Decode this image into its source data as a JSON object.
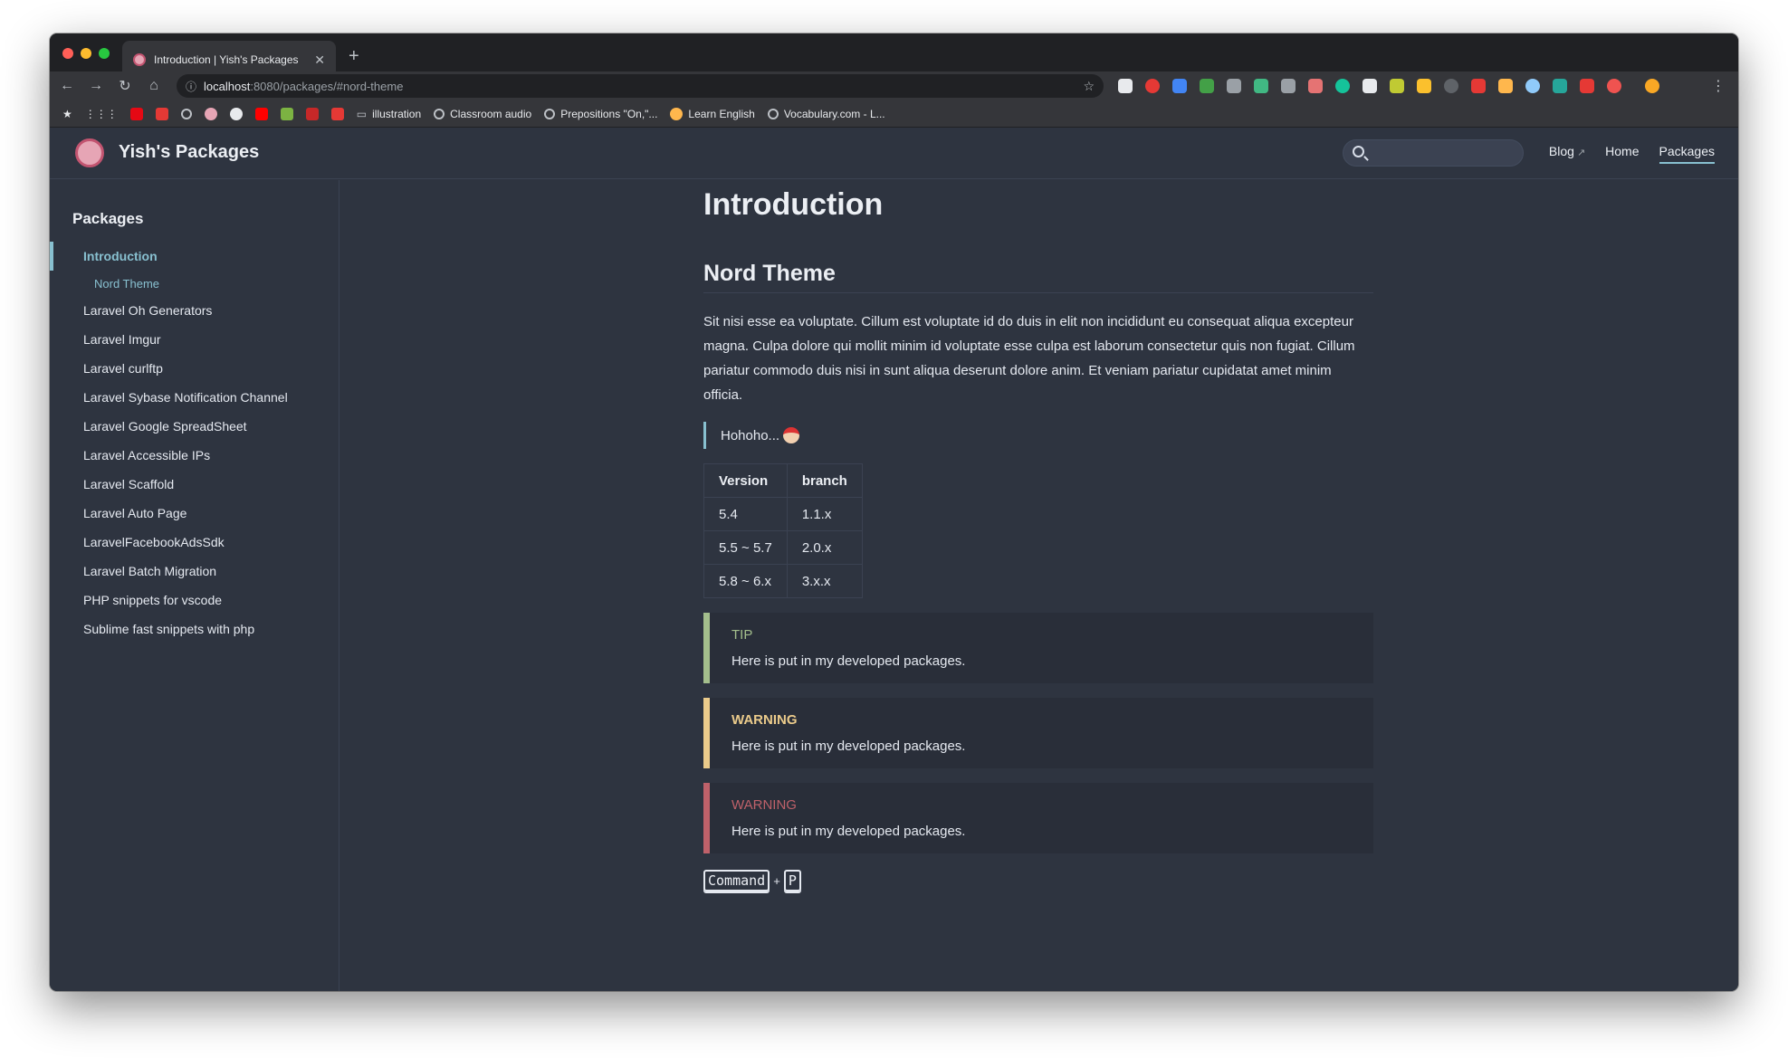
{
  "browser": {
    "tab_title": "Introduction | Yish's Packages",
    "url_host": "localhost",
    "url_rest": ":8080/packages/#nord-theme",
    "bookmarks": [
      {
        "label": "illustration",
        "icon": "folder-icon"
      },
      {
        "label": "Classroom audio",
        "icon": "globe-icon"
      },
      {
        "label": "Prepositions \"On,\"...",
        "icon": "globe-icon"
      },
      {
        "label": "Learn English",
        "icon": "learn-english-icon"
      },
      {
        "label": "Vocabulary.com - L...",
        "icon": "globe-icon"
      }
    ]
  },
  "site": {
    "title": "Yish's Packages",
    "search_placeholder": "",
    "nav": {
      "blog": "Blog",
      "home": "Home",
      "packages": "Packages"
    }
  },
  "sidebar": {
    "heading": "Packages",
    "active": "Introduction",
    "sub_active": "Nord Theme",
    "items": [
      "Laravel Oh Generators",
      "Laravel Imgur",
      "Laravel curlftp",
      "Laravel Sybase Notification Channel",
      "Laravel Google SpreadSheet",
      "Laravel Accessible IPs",
      "Laravel Scaffold",
      "Laravel Auto Page",
      "LaravelFacebookAdsSdk",
      "Laravel Batch Migration",
      "PHP snippets for vscode",
      "Sublime fast snippets with php"
    ]
  },
  "content": {
    "h1": "Introduction",
    "h2": "Nord Theme",
    "paragraph": "Sit nisi esse ea voluptate. Cillum est voluptate id do duis in elit non incididunt eu consequat aliqua excepteur magna. Culpa dolore qui mollit minim id voluptate esse culpa est laborum consectetur quis non fugiat. Cillum pariatur commodo duis nisi in sunt aliqua deserunt dolore anim. Et veniam pariatur cupidatat amet minim officia.",
    "quote": "Hohoho...",
    "table": {
      "headers": [
        "Version",
        "branch"
      ],
      "rows": [
        [
          "5.4",
          "1.1.x"
        ],
        [
          "5.5 ~ 5.7",
          "2.0.x"
        ],
        [
          "5.8 ~ 6.x",
          "3.x.x"
        ]
      ]
    },
    "tip": {
      "title": "TIP",
      "text": "Here is put in my developed packages."
    },
    "warning": {
      "title": "WARNING",
      "text": "Here is put in my developed packages."
    },
    "danger": {
      "title": "WARNING",
      "text": "Here is put in my developed packages."
    },
    "kbd": {
      "key1": "Command",
      "plus": "+",
      "key2": "P"
    }
  },
  "colors": {
    "background": "#2e3440",
    "accent": "#88c0d0",
    "tip": "#a3be8c",
    "warning": "#ebcb8b",
    "danger": "#bf616a"
  }
}
